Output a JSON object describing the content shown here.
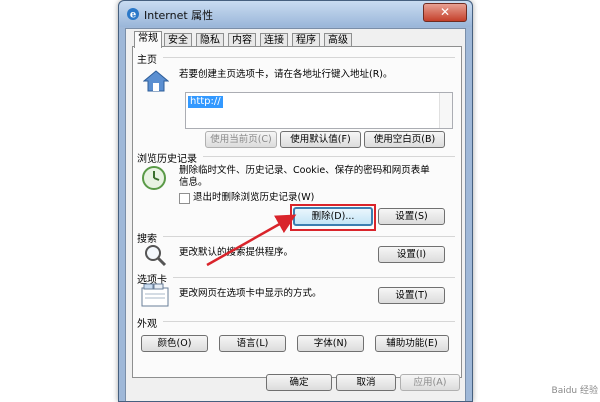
{
  "window": {
    "title": "Internet 属性",
    "close_glyph": "✕"
  },
  "tabs": [
    "常规",
    "安全",
    "隐私",
    "内容",
    "连接",
    "程序",
    "高级"
  ],
  "homepage": {
    "title": "主页",
    "description": "若要创建主页选项卡，请在各地址行键入地址(R)。",
    "address": "http://",
    "buttons": [
      "使用当前页(C)",
      "使用默认值(F)",
      "使用空白页(B)"
    ]
  },
  "history": {
    "title": "浏览历史记录",
    "description_line1": "删除临时文件、历史记录、Cookie、保存的密码和网页表单",
    "description_line2": "信息。",
    "checkbox_label": "退出时删除浏览历史记录(W)",
    "delete_button": "删除(D)...",
    "settings_button": "设置(S)"
  },
  "search": {
    "title": "搜索",
    "description": "更改默认的搜索提供程序。",
    "settings_button": "设置(I)"
  },
  "tabs_section": {
    "title": "选项卡",
    "description": "更改网页在选项卡中显示的方式。",
    "settings_button": "设置(T)"
  },
  "appearance": {
    "title": "外观",
    "buttons": [
      "颜色(O)",
      "语言(L)",
      "字体(N)",
      "辅助功能(E)"
    ]
  },
  "footer": {
    "ok": "确定",
    "cancel": "取消",
    "apply": "应用(A)"
  },
  "watermark": "Baidu 经验",
  "colors": {
    "highlight": "#d9242b",
    "arrow": "#d9242b",
    "selection": "#3399ff"
  }
}
